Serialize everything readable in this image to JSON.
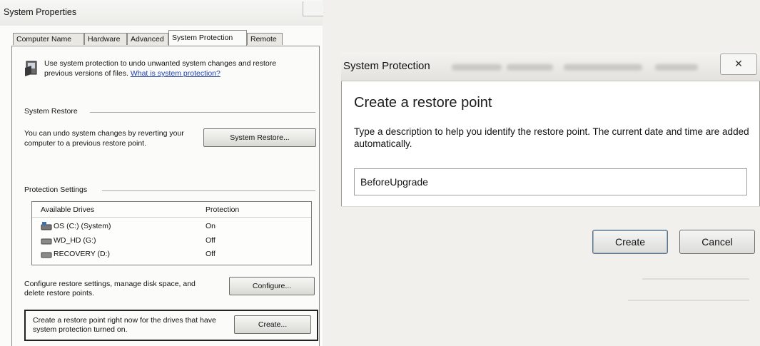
{
  "system_properties": {
    "title": "System Properties",
    "tabs": [
      {
        "label": "Computer Name"
      },
      {
        "label": "Hardware"
      },
      {
        "label": "Advanced"
      },
      {
        "label": "System Protection"
      },
      {
        "label": "Remote"
      }
    ],
    "active_tab": "System Protection",
    "intro_text": "Use system protection to undo unwanted system changes and restore previous versions of files.",
    "intro_link": "What is system protection?",
    "system_restore": {
      "header": "System Restore",
      "text": "You can undo system changes by reverting your computer to a previous restore point.",
      "button": "System Restore..."
    },
    "protection_settings": {
      "header": "Protection Settings",
      "columns": [
        "Available Drives",
        "Protection"
      ],
      "drives": [
        {
          "name": "OS (C:) (System)",
          "protection": "On",
          "icon": "system-drive-icon"
        },
        {
          "name": "WD_HD (G:)",
          "protection": "Off",
          "icon": "drive-icon"
        },
        {
          "name": "RECOVERY (D:)",
          "protection": "Off",
          "icon": "drive-icon"
        }
      ],
      "configure_text": "Configure restore settings, manage disk space, and delete restore points.",
      "configure_button": "Configure...",
      "create_text": "Create a restore point right now for the drives that have system protection turned on.",
      "create_button": "Create..."
    }
  },
  "restore_dialog": {
    "title": "System Protection",
    "close_glyph": "✕",
    "heading": "Create a restore point",
    "description": "Type a description to help you identify the restore point. The current date and time are added automatically.",
    "input_value": "BeforeUpgrade",
    "create_button": "Create",
    "cancel_button": "Cancel"
  }
}
